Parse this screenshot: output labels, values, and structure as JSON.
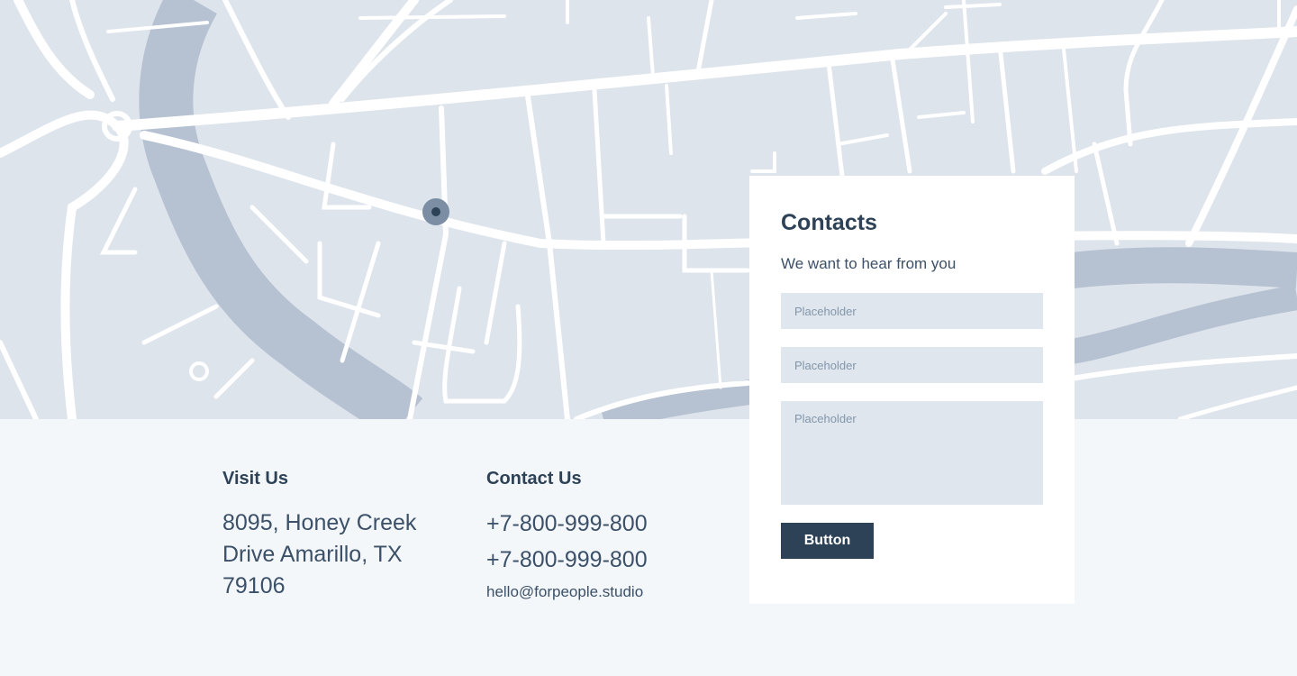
{
  "colors": {
    "map_background": "#dde4ec",
    "river": "#b6c1d2",
    "road": "#ffffff",
    "page_background": "#f3f7fa",
    "primary": "#2e4257",
    "field_background": "#dfe6ee"
  },
  "map": {
    "pin_icon": "location-pin-icon"
  },
  "visit": {
    "title": "Visit Us",
    "address": "8095, Honey Creek Drive Amarillo, TX 79106"
  },
  "contact": {
    "title": "Contact Us",
    "phone1": "+7-800-999-800",
    "phone2": "+7-800-999-800",
    "email": "hello@forpeople.studio"
  },
  "form": {
    "title": "Contacts",
    "subtitle": "We want to hear from you",
    "field1_placeholder": "Placeholder",
    "field2_placeholder": "Placeholder",
    "message_placeholder": "Placeholder",
    "button_label": "Button"
  }
}
